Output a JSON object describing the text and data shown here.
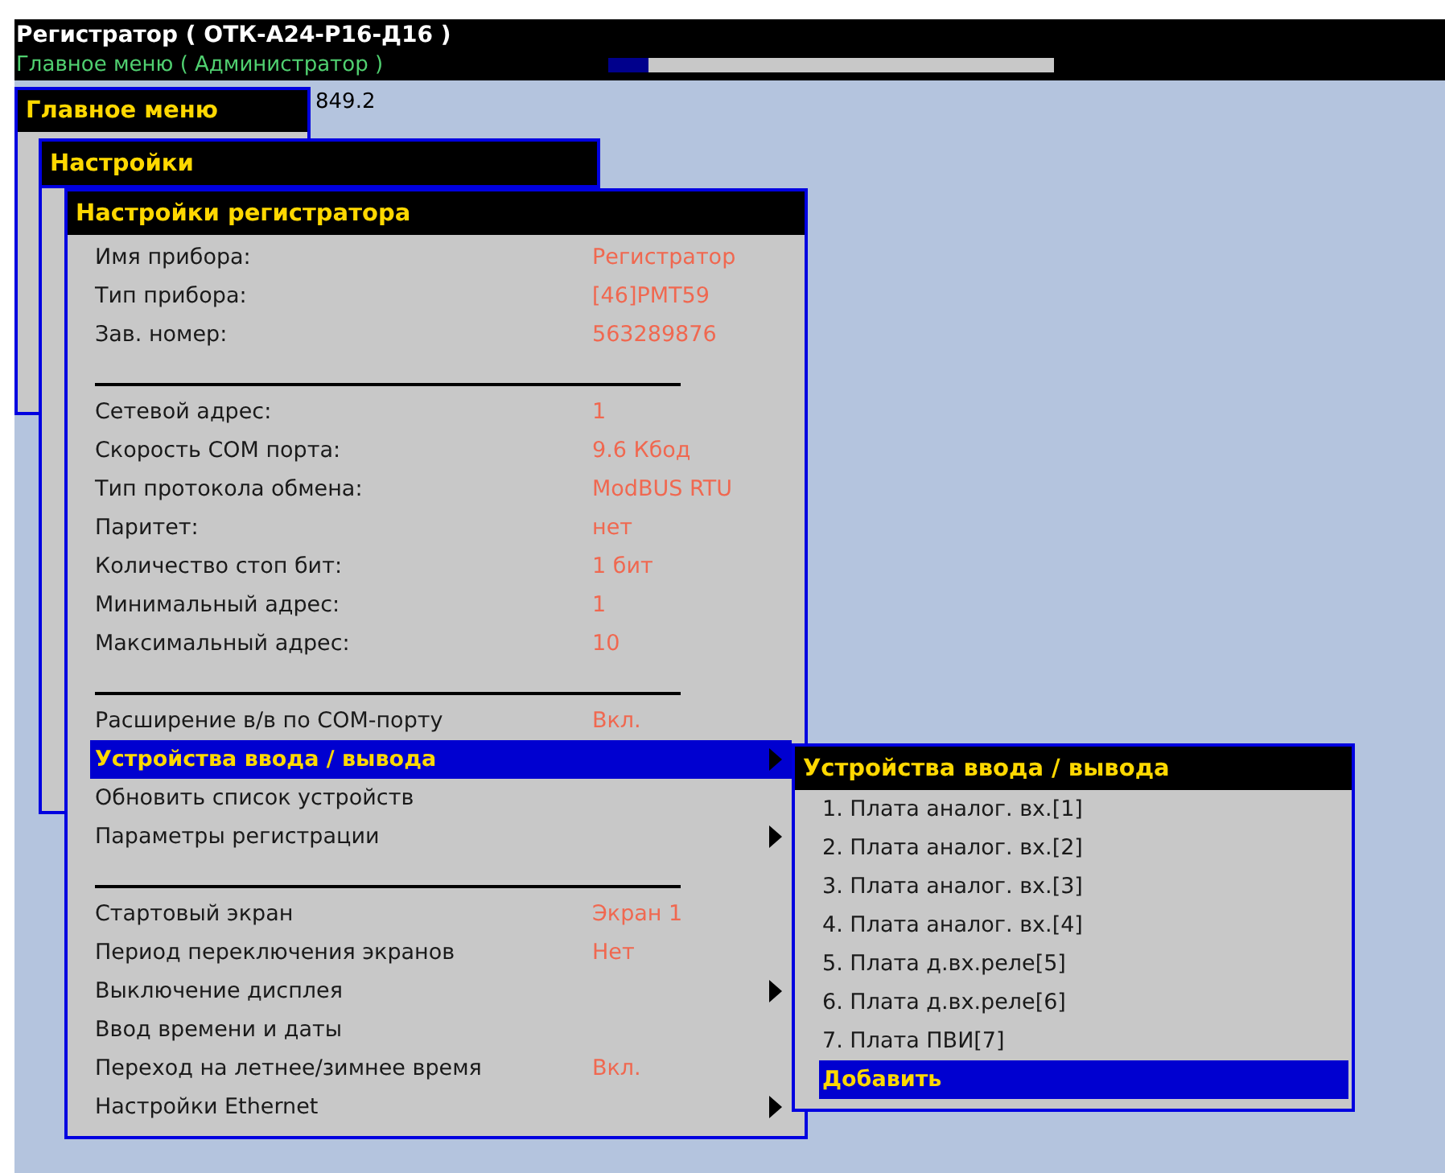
{
  "header": {
    "title": "Регистратор ( ОТК-А24-Р16-Д16 )",
    "subtitle": "Главное меню ( Администратор )",
    "progress": {
      "level": 0.09
    }
  },
  "reading": "849.2",
  "windows": [
    {
      "title": "Главное меню"
    },
    {
      "title": "Настройки"
    },
    {
      "title": "Настройки регистратора",
      "items": [
        {
          "kind": "item",
          "label": "Имя прибора:",
          "value": "Регистратор",
          "submenu": false,
          "selected": false
        },
        {
          "kind": "item",
          "label": "Тип прибора:",
          "value": "[46]РМТ59",
          "submenu": false,
          "selected": false
        },
        {
          "kind": "item",
          "label": "Зав. номер:",
          "value": "563289876",
          "submenu": false,
          "selected": false
        },
        {
          "kind": "separator"
        },
        {
          "kind": "item",
          "label": "Сетевой адрес:",
          "value": "1",
          "submenu": false,
          "selected": false
        },
        {
          "kind": "item",
          "label": "Скорость СОМ порта:",
          "value": "9.6 Кбод",
          "submenu": false,
          "selected": false
        },
        {
          "kind": "item",
          "label": "Тип протокола обмена:",
          "value": "ModBUS RTU",
          "submenu": false,
          "selected": false
        },
        {
          "kind": "item",
          "label": "Паритет:",
          "value": "нет",
          "submenu": false,
          "selected": false
        },
        {
          "kind": "item",
          "label": "Количество стоп бит:",
          "value": "1 бит",
          "submenu": false,
          "selected": false
        },
        {
          "kind": "item",
          "label": "Минимальный адрес:",
          "value": "1",
          "submenu": false,
          "selected": false
        },
        {
          "kind": "item",
          "label": "Максимальный адрес:",
          "value": "10",
          "submenu": false,
          "selected": false
        },
        {
          "kind": "separator"
        },
        {
          "kind": "item",
          "label": "Расширение в/в по СОМ-порту",
          "value": "Вкл.",
          "submenu": false,
          "selected": false
        },
        {
          "kind": "item",
          "label": "Устройства ввода / вывода",
          "submenu": true,
          "selected": true
        },
        {
          "kind": "item",
          "label": "Обновить список устройств",
          "submenu": false,
          "selected": false
        },
        {
          "kind": "item",
          "label": "Параметры регистрации",
          "submenu": true,
          "selected": false
        },
        {
          "kind": "separator"
        },
        {
          "kind": "item",
          "label": "Стартовый экран",
          "value": "Экран 1",
          "submenu": false,
          "selected": false
        },
        {
          "kind": "item",
          "label": "Период переключения экранов",
          "value": "Нет",
          "submenu": false,
          "selected": false
        },
        {
          "kind": "item",
          "label": "Выключение дисплея",
          "submenu": true,
          "selected": false
        },
        {
          "kind": "item",
          "label": "Ввод времени и даты",
          "submenu": false,
          "selected": false
        },
        {
          "kind": "item",
          "label": "Переход на летнее/зимнее время",
          "value": "Вкл.",
          "submenu": false,
          "selected": false
        },
        {
          "kind": "item",
          "label": "Настройки Ethernet",
          "submenu": true,
          "selected": false
        }
      ]
    },
    {
      "title": "Устройства ввода / вывода",
      "items": [
        {
          "kind": "item",
          "label": "1. Плата аналог. вх.[1]",
          "submenu": false,
          "selected": false
        },
        {
          "kind": "item",
          "label": "2. Плата аналог. вх.[2]",
          "submenu": false,
          "selected": false
        },
        {
          "kind": "item",
          "label": "3. Плата аналог. вх.[3]",
          "submenu": false,
          "selected": false
        },
        {
          "kind": "item",
          "label": "4. Плата аналог. вх.[4]",
          "submenu": false,
          "selected": false
        },
        {
          "kind": "item",
          "label": "5. Плата д.вх.реле[5]",
          "submenu": false,
          "selected": false
        },
        {
          "kind": "item",
          "label": "6. Плата д.вх.реле[6]",
          "submenu": false,
          "selected": false
        },
        {
          "kind": "item",
          "label": "7. Плата ПВИ[7]",
          "submenu": false,
          "selected": false
        },
        {
          "kind": "item",
          "label": "Добавить",
          "submenu": false,
          "selected": true
        }
      ]
    }
  ]
}
